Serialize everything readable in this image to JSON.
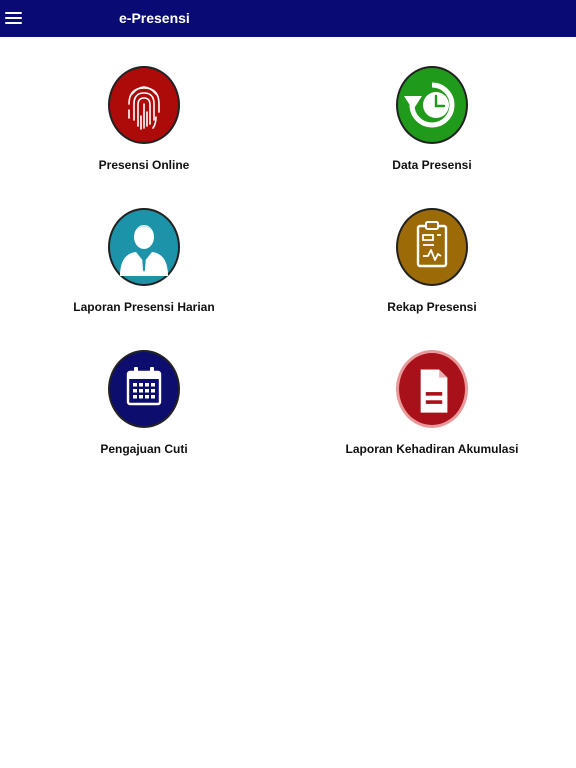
{
  "header": {
    "title": "e-Presensi"
  },
  "colors": {
    "appbar": "#0a0a74",
    "fingerprint": "#ad0a0a",
    "data": "#1f9a1a",
    "laporan_harian": "#1c93a8",
    "rekap": "#9c6a06",
    "cuti": "#0d0d6e",
    "akumulasi": "#a8111a"
  },
  "menu": [
    {
      "label": "Presensi Online",
      "icon": "fingerprint-icon"
    },
    {
      "label": "Data Presensi",
      "icon": "clock-refresh-icon"
    },
    {
      "label": "Laporan Presensi Harian",
      "icon": "user-icon"
    },
    {
      "label": "Rekap Presensi",
      "icon": "clipboard-icon"
    },
    {
      "label": "Pengajuan Cuti",
      "icon": "calendar-icon"
    },
    {
      "label": "Laporan Kehadiran Akumulasi",
      "icon": "document-icon"
    }
  ]
}
